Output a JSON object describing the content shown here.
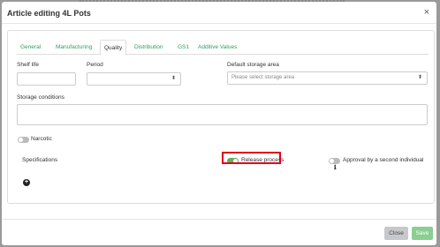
{
  "modal": {
    "title": "Article editing 4L Pots",
    "close_icon": "×"
  },
  "tabs": [
    {
      "label": "General",
      "active": false
    },
    {
      "label": "Manufacturing",
      "active": false
    },
    {
      "label": "Quality",
      "active": true
    },
    {
      "label": "Distribution",
      "active": false
    },
    {
      "label": "GS1",
      "active": false
    },
    {
      "label": "Additive Values",
      "active": false
    }
  ],
  "form": {
    "shelf_life_label": "Shelf life",
    "shelf_life_value": "",
    "period_label": "Period",
    "period_value": "",
    "default_storage_label": "Default storage area",
    "default_storage_placeholder": "Please select storage area",
    "storage_conditions_label": "Storage conditions",
    "storage_conditions_value": "",
    "narcotic_label": "Narcotic",
    "narcotic_on": false,
    "specifications_label": "Specifications",
    "release_process_label": "Release process",
    "release_process_on": true,
    "approval_label": "Approval by a second individual",
    "approval_on": false,
    "info_icon": "ℹ",
    "add_icon": "+"
  },
  "footer": {
    "close_label": "Close",
    "save_label": "Save"
  },
  "colors": {
    "accent": "#2e9e5c",
    "toggle_on": "#5fb160",
    "highlight": "#e0001a",
    "save": "#8bce92"
  }
}
